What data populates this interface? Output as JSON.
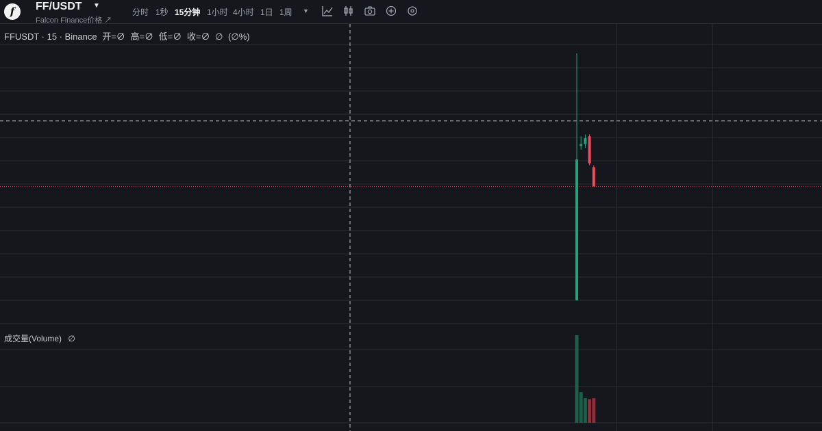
{
  "header": {
    "logo_glyph": "f",
    "pair": "FF/USDT",
    "subtitle": "Falcon Finance价格 ↗",
    "timeframes": [
      "分时",
      "1秒",
      "15分钟",
      "1小时",
      "4小时",
      "1日",
      "1周"
    ],
    "active_timeframe": "15分钟",
    "tools": [
      "chart-style-icon",
      "candle-icon",
      "camera-icon",
      "add-circle-icon",
      "settings-icon"
    ]
  },
  "legend": {
    "symbol": "FFUSDT · 15 · Binance",
    "open": "开=∅",
    "high": "高=∅",
    "low": "低=∅",
    "close": "收=∅",
    "change": "∅",
    "change_pct": "(∅%)"
  },
  "volume_legend": {
    "label": "成交量(Volume)",
    "value": "∅"
  },
  "colors": {
    "up": "#26a17b",
    "down": "#ef4b5e",
    "volume_up": "#1f5e4a",
    "volume_down": "#8a2f3b",
    "grid": "#2a2d35",
    "crosshair": "#c0c4cc",
    "price_line": "#d9485a"
  },
  "chart_data": {
    "type": "candlestick",
    "ohlc": [
      {
        "open": 0.02,
        "high": 1.3,
        "low": 0.02,
        "close": 0.75
      },
      {
        "open": 0.82,
        "high": 0.87,
        "low": 0.8,
        "close": 0.83
      },
      {
        "open": 0.83,
        "high": 0.88,
        "low": 0.81,
        "close": 0.86
      },
      {
        "open": 0.87,
        "high": 0.88,
        "low": 0.72,
        "close": 0.73
      },
      {
        "open": 0.71,
        "high": 0.72,
        "low": 0.61,
        "close": 0.61
      }
    ],
    "volume": [
      100,
      35,
      28,
      27,
      28
    ],
    "last_price": 0.61,
    "crosshair_price": 0.95,
    "grid": true
  }
}
